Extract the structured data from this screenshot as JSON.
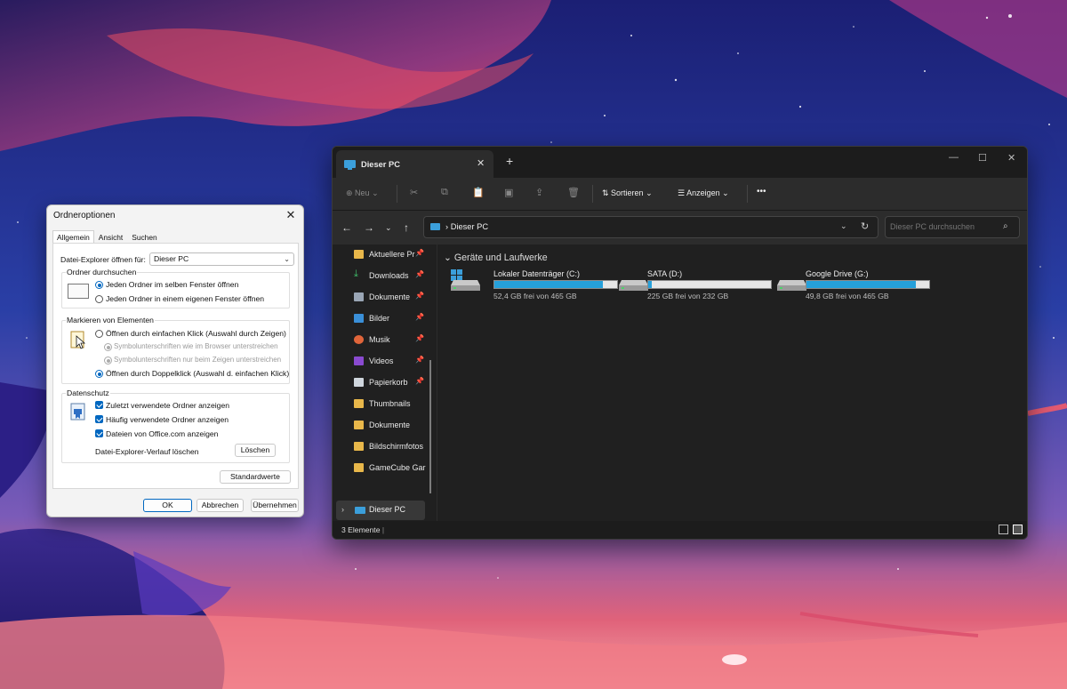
{
  "dialog": {
    "title": "Ordneroptionen",
    "tabs": [
      "Allgemein",
      "Ansicht",
      "Suchen"
    ],
    "open_for_label": "Datei-Explorer öffnen für:",
    "open_for_value": "Dieser PC",
    "group_browse": {
      "label": "Ordner durchsuchen",
      "options": [
        "Jeden Ordner im selben Fenster öffnen",
        "Jeden Ordner in einem eigenen Fenster öffnen"
      ],
      "selected": 0
    },
    "group_mark": {
      "label": "Markieren von Elementen",
      "opt_single": "Öffnen durch einfachen Klick (Auswahl durch Zeigen)",
      "sub1": "Symbolunterschriften wie im Browser unterstreichen",
      "sub2": "Symbolunterschriften nur beim Zeigen unterstreichen",
      "opt_double": "Öffnen durch Doppelklick (Auswahl d. einfachen Klick)"
    },
    "group_privacy": {
      "label": "Datenschutz",
      "checks": [
        "Zuletzt verwendete Ordner anzeigen",
        "Häufig verwendete Ordner anzeigen",
        "Dateien von Office.com anzeigen"
      ],
      "clear_label": "Datei-Explorer-Verlauf löschen",
      "clear_button": "Löschen"
    },
    "defaults_button": "Standardwerte",
    "ok": "OK",
    "cancel": "Abbrechen",
    "apply": "Übernehmen"
  },
  "explorer": {
    "tab_title": "Dieser PC",
    "toolbar": {
      "new": "Neu",
      "sort": "Sortieren",
      "view": "Anzeigen",
      "more": "•••"
    },
    "address": "Dieser PC",
    "search_placeholder": "Dieser PC durchsuchen",
    "nav_items": [
      {
        "label": "Aktuellere Pr",
        "icon": "home-folder-icon",
        "pinned": true
      },
      {
        "label": "Downloads",
        "icon": "download-icon",
        "pinned": true
      },
      {
        "label": "Dokumente",
        "icon": "document-icon",
        "pinned": true
      },
      {
        "label": "Bilder",
        "icon": "pictures-icon",
        "pinned": true
      },
      {
        "label": "Musik",
        "icon": "music-icon",
        "pinned": true
      },
      {
        "label": "Videos",
        "icon": "videos-icon",
        "pinned": true
      },
      {
        "label": "Papierkorb",
        "icon": "recycle-bin-icon",
        "pinned": true
      },
      {
        "label": "Thumbnails",
        "icon": "folder-icon",
        "pinned": false
      },
      {
        "label": "Dokumente",
        "icon": "folder-icon",
        "pinned": false
      },
      {
        "label": "Bildschirmfotos",
        "icon": "folder-icon",
        "pinned": false
      },
      {
        "label": "GameCube Garr",
        "icon": "folder-icon",
        "pinned": false
      }
    ],
    "nav_pc": "Dieser PC",
    "section_title": "Geräte und Laufwerke",
    "drives": [
      {
        "name": "Lokaler Datenträger (C:)",
        "free": "52,4 GB frei von 465 GB",
        "used_fraction": 0.887
      },
      {
        "name": "SATA (D:)",
        "free": "225 GB frei von 232 GB",
        "used_fraction": 0.03
      },
      {
        "name": "Google Drive (G:)",
        "free": "49,8 GB frei von 465 GB",
        "used_fraction": 0.893
      }
    ],
    "status": "3 Elemente",
    "colors": {
      "accent": "#26a0da",
      "background": "#202020",
      "panel": "#2c2c2c"
    }
  }
}
